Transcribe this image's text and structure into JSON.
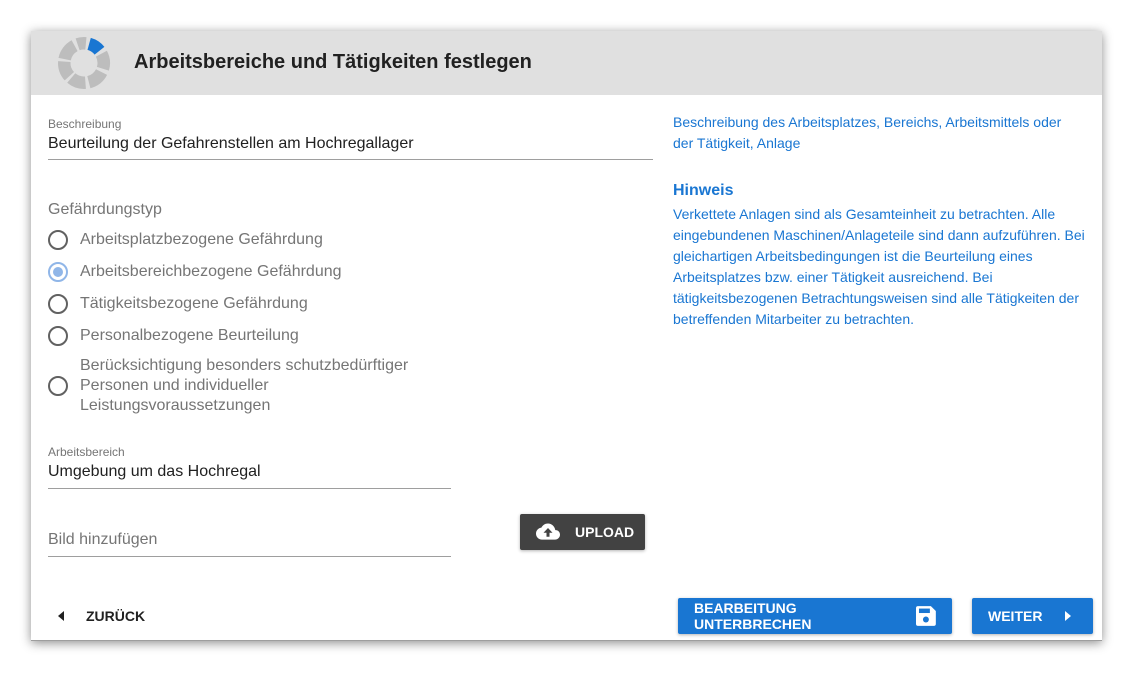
{
  "header": {
    "title": "Arbeitsbereiche und Tätigkeiten festlegen",
    "logo_icon": "segmented-ring-icon"
  },
  "form": {
    "beschreibung": {
      "label": "Beschreibung",
      "value": "Beurteilung der Gefahrenstellen am Hochregallager"
    },
    "gefaehrdungstyp": {
      "label": "Gefährdungstyp",
      "options": [
        "Arbeitsplatzbezogene Gefährdung",
        "Arbeitsbereichbezogene Gefährdung",
        "Tätigkeitsbezogene Gefährdung",
        "Personalbezogene Beurteilung",
        "Berücksichtigung besonders schutzbedürftiger Personen und individueller Leistungsvoraussetzungen"
      ],
      "selected_index": 1
    },
    "arbeitsbereich": {
      "label": "Arbeitsbereich",
      "value": "Umgebung um das Hochregal"
    },
    "bild": {
      "placeholder": "Bild hinzufügen"
    },
    "upload_label": "UPLOAD"
  },
  "help": {
    "beschreibung_text": "Beschreibung des Arbeitsplatzes, Bereichs, Arbeitsmittels oder der Tätigkeit, Anlage",
    "hint_title": "Hinweis",
    "hint_text": "Verkettete Anlagen sind als Gesamteinheit zu betrachten. Alle eingebundenen Maschinen/Anlageteile sind dann aufzuführen. Bei gleichartigen Arbeitsbedingungen ist die Beurteilung eines Arbeitsplatzes bzw. einer Tätigkeit ausreichend. Bei tätigkeitsbezogenen Betrachtungsweisen sind alle Tätigkeiten der betreffenden Mitarbeiter zu betrachten."
  },
  "footer": {
    "back_label": "ZURÜCK",
    "pause_label": "BEARBEITUNG UNTERBRECHEN",
    "next_label": "WEITER"
  },
  "colors": {
    "primary": "#1976d2",
    "header_bg": "#e0e0e0",
    "dark_button": "#424242",
    "radio_selected": "#90b6e8"
  }
}
